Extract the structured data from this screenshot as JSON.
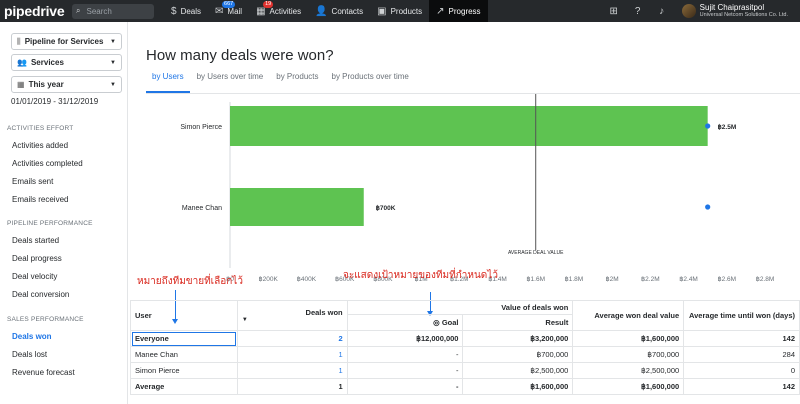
{
  "topbar": {
    "logo": "pipedrive",
    "search_placeholder": "Search",
    "nav": [
      {
        "icon": "$",
        "label": "Deals",
        "badge": ""
      },
      {
        "icon": "✉",
        "label": "Mail",
        "badge": "667"
      },
      {
        "icon": "▦",
        "label": "Activities",
        "badge": "19"
      },
      {
        "icon": "👤",
        "label": "Contacts",
        "badge": ""
      },
      {
        "icon": "▣",
        "label": "Products",
        "badge": ""
      },
      {
        "icon": "↗",
        "label": "Progress",
        "badge": ""
      }
    ],
    "user_name": "Sujit Chaiprasitpol",
    "user_company": "Universal Netcom Solutions Co. Ltd."
  },
  "sidebar": {
    "pipeline": "Pipeline for Services",
    "filter": "Services",
    "period": "This year",
    "date_range": "01/01/2019 - 31/12/2019",
    "sections": [
      {
        "title": "ACTIVITIES EFFORT",
        "items": [
          "Activities added",
          "Activities completed",
          "Emails sent",
          "Emails received"
        ]
      },
      {
        "title": "PIPELINE PERFORMANCE",
        "items": [
          "Deals started",
          "Deal progress",
          "Deal velocity",
          "Deal conversion"
        ]
      },
      {
        "title": "SALES PERFORMANCE",
        "items": [
          "Deals won",
          "Deals lost",
          "Revenue forecast"
        ]
      }
    ],
    "active_item": "Deals won"
  },
  "main": {
    "title": "How many deals were won?",
    "tabs": [
      "by Users",
      "by Users over time",
      "by Products",
      "by Products over time"
    ],
    "active_tab": "by Users"
  },
  "chart_data": {
    "type": "bar",
    "orientation": "horizontal",
    "categories": [
      "Simon Pierce",
      "Manee Chan"
    ],
    "values": [
      2500000,
      700000
    ],
    "value_labels": [
      "฿2.5M",
      "฿700K"
    ],
    "goal_marker_values": [
      2500000,
      2500000
    ],
    "xlim": [
      0,
      2800000
    ],
    "x_ticks": [
      "฿0",
      "฿200K",
      "฿400K",
      "฿600K",
      "฿800K",
      "฿1M",
      "฿1.2M",
      "฿1.4M",
      "฿1.6M",
      "฿1.8M",
      "฿2M",
      "฿2.2M",
      "฿2.4M",
      "฿2.6M",
      "฿2.8M"
    ],
    "average_line_value": 1600000,
    "average_line_label": "AVERAGE DEAL VALUE",
    "bar_color": "#5ec351",
    "marker_color": "#1f76e6"
  },
  "annotations": {
    "left": "หมายถึงทีมขายที่เลือกไว้",
    "right": "จะแสดงเป้าหมายของทีมที่กำหนดไว้"
  },
  "table": {
    "headers": {
      "user": "User",
      "deals_won": "Deals won",
      "value_group": "Value of deals won",
      "goal": "Goal",
      "result": "Result",
      "avg_value": "Average won deal value",
      "avg_time": "Average time until won (days)"
    },
    "rows": [
      {
        "user": "Everyone",
        "deals": "2",
        "goal": "฿12,000,000",
        "result": "฿3,200,000",
        "avg": "฿1,600,000",
        "time": "142"
      },
      {
        "user": "Manee Chan",
        "deals": "1",
        "goal": "-",
        "result": "฿700,000",
        "avg": "฿700,000",
        "time": "284"
      },
      {
        "user": "Simon Pierce",
        "deals": "1",
        "goal": "-",
        "result": "฿2,500,000",
        "avg": "฿2,500,000",
        "time": "0"
      },
      {
        "user": "Average",
        "deals": "1",
        "goal": "-",
        "result": "฿1,600,000",
        "avg": "฿1,600,000",
        "time": "142"
      }
    ]
  }
}
